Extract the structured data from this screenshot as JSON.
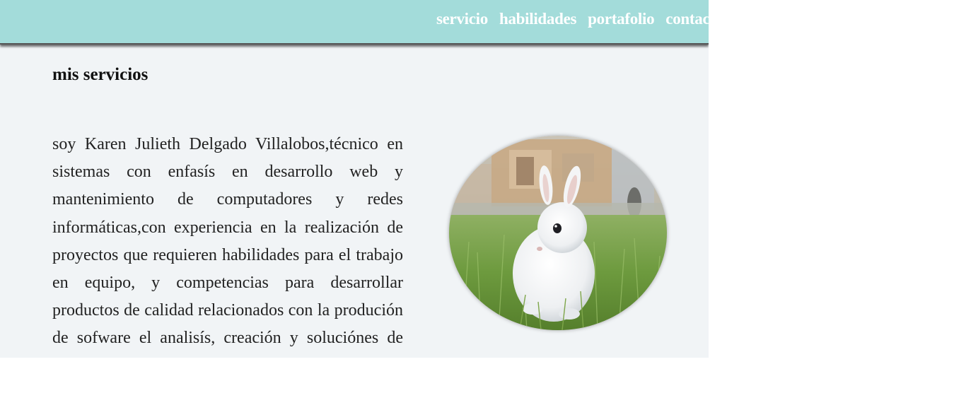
{
  "nav": {
    "items": [
      {
        "label": "servicio"
      },
      {
        "label": "habilidades"
      },
      {
        "label": "portafolio"
      },
      {
        "label": "contacto"
      }
    ]
  },
  "section": {
    "title": "mis servicios",
    "text": "soy Karen Julieth Delgado Villalobos,técnico en sistemas con enfasís en desarrollo web y mantenimiento de computadores y redes informáticas,con experiencia en la realización de proyectos que requieren habilidades para el trabajo en equipo, y competencias para desarrollar productos de calidad relacionados con la produción de sofware el analisís, creación y soluciónes de problemas que las intervienen."
  },
  "image": {
    "subject": "white-rabbit-in-grass-photo"
  },
  "colors": {
    "navbar": "#a3dcda",
    "page_bg": "#f1f4f6",
    "nav_text": "#ffffff"
  }
}
